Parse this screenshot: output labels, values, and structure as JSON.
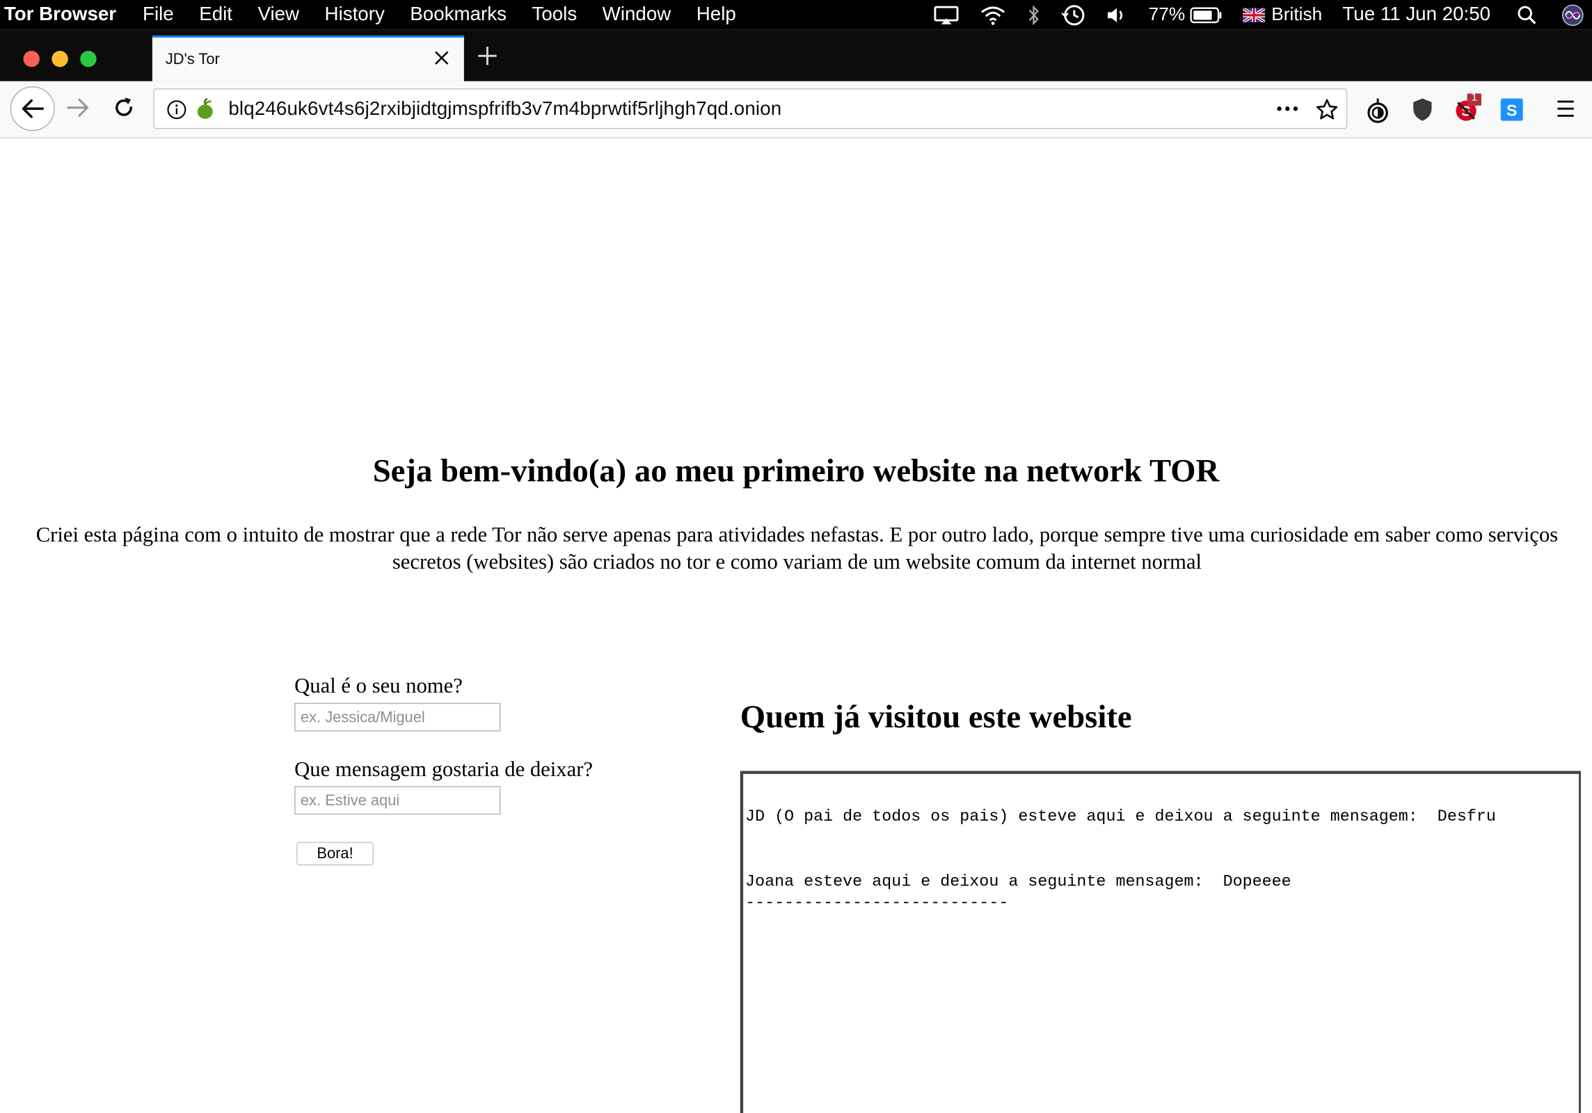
{
  "menubar": {
    "app_name": "Tor Browser",
    "menus": [
      "File",
      "Edit",
      "View",
      "History",
      "Bookmarks",
      "Tools",
      "Window",
      "Help"
    ],
    "battery": "77%",
    "keyboard_layout": "British",
    "clock": "Tue 11 Jun  20:50"
  },
  "browser": {
    "tab_title": "JD's Tor",
    "url": "blq246uk6vt4s6j2rxibjidtgjmspfrifb3v7m4bprwtif5rljhgh7qd.onion",
    "notification_badge": "1",
    "accent_color": "#0a84ff"
  },
  "page": {
    "heading": "Seja bem-vindo(a) ao meu primeiro website na network TOR",
    "intro": "Criei esta página com o intuito de mostrar que a rede Tor não serve apenas para atividades nefastas. E por outro lado, porque sempre tive uma curiosidade em saber como serviços secretos (websites) são criados no tor e como variam de um website comum da internet normal",
    "form": {
      "name_label": "Qual é o seu nome?",
      "name_placeholder": "ex. Jessica/Miguel",
      "message_label": "Que mensagem gostaria de deixar?",
      "message_placeholder": "ex. Estive aqui",
      "submit_label": "Bora!"
    },
    "visitors_heading": "Quem já visitou este website",
    "visitors": [
      "JD (O pai de todos os pais) esteve aqui e deixou a seguinte mensagem:  Desfru",
      "Joana esteve aqui e deixou a seguinte mensagem:  Dopeeee"
    ],
    "separator": "---------------------------"
  }
}
